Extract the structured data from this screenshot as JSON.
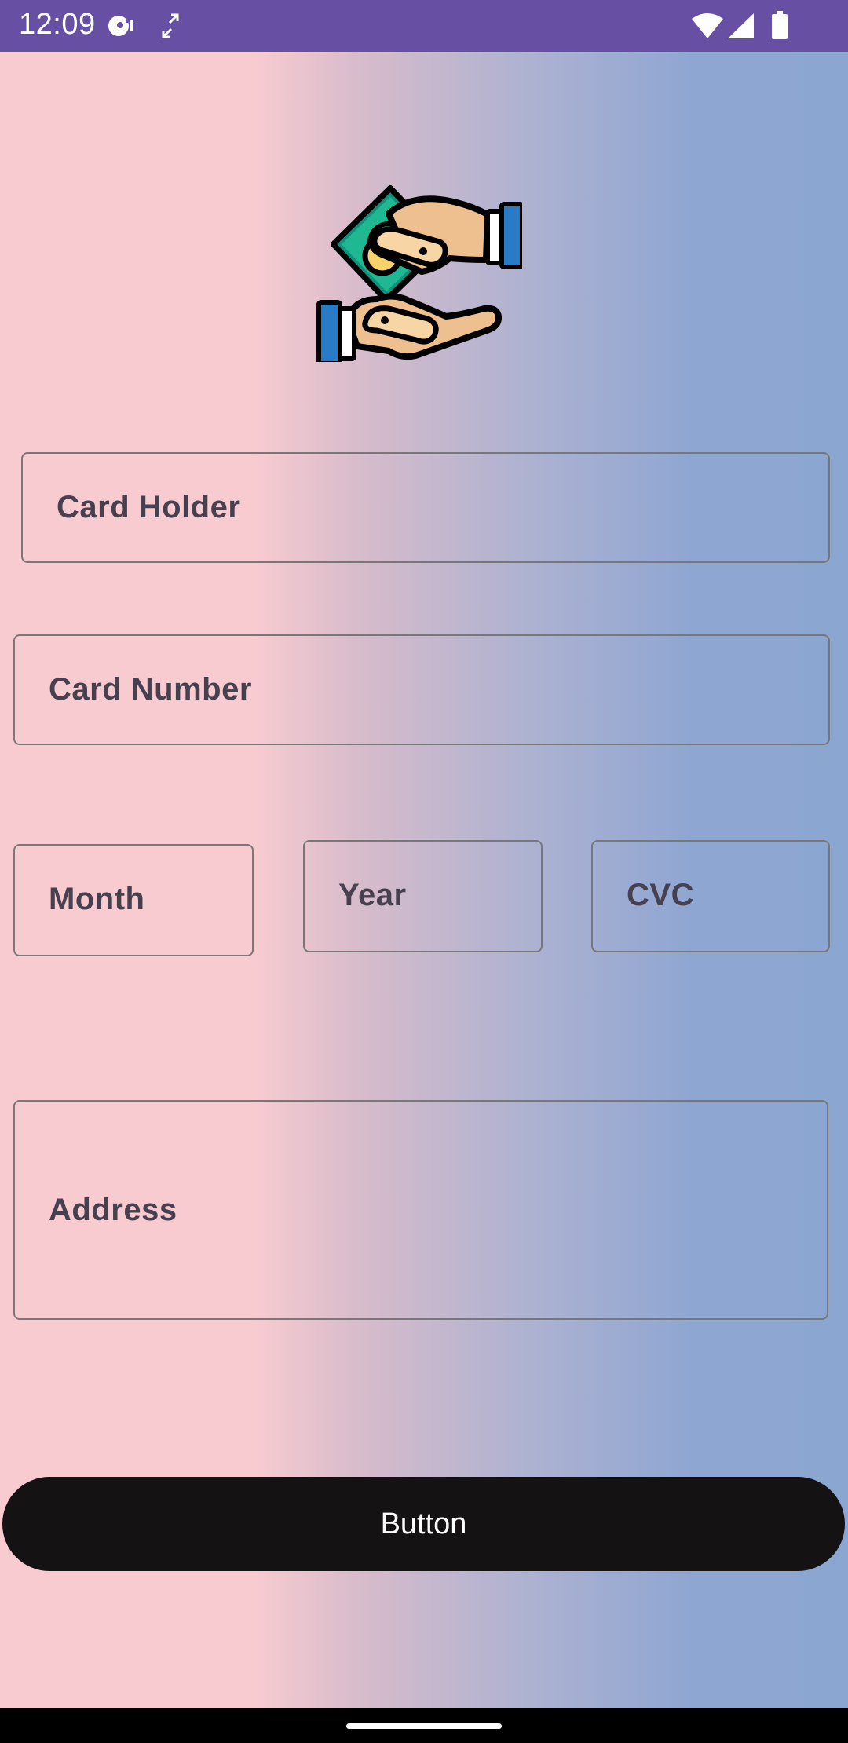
{
  "status_bar": {
    "time": "12:09",
    "icons": [
      "media-icon",
      "sync-icon",
      "wifi-icon",
      "signal-icon",
      "battery-icon"
    ],
    "background": "#6750a4"
  },
  "illustration": {
    "icon": "money-transfer-hands-icon"
  },
  "form": {
    "card_holder_label": "Card Holder",
    "card_number_label": "Card Number",
    "month_label": "Month",
    "year_label": "Year",
    "cvc_label": "CVC",
    "address_label": "Address",
    "submit_label": "Button"
  },
  "colors": {
    "gradient_start": "#f8cbd0",
    "gradient_end": "#8ca6d2",
    "button_background": "#141213",
    "label_color": "#47414f",
    "field_border": "#797879"
  }
}
